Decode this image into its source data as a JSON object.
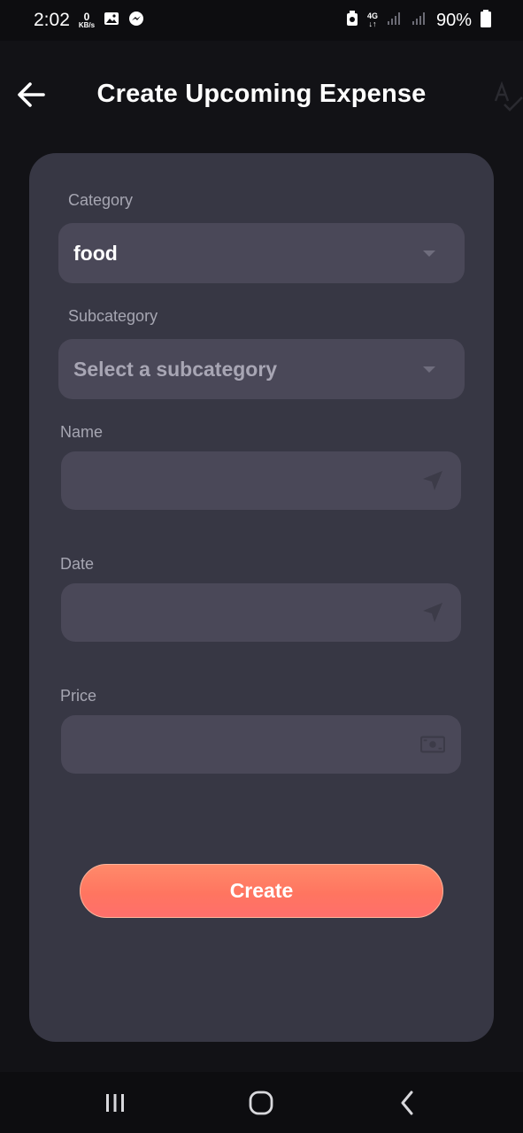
{
  "status_bar": {
    "time": "2:02",
    "data_speed_value": "0",
    "data_speed_unit": "KB/s",
    "network": "4G",
    "battery": "90%"
  },
  "app_bar": {
    "title": "Create Upcoming Expense"
  },
  "form": {
    "category": {
      "label": "Category",
      "value": "food"
    },
    "subcategory": {
      "label": "Subcategory",
      "placeholder": "Select a subcategory"
    },
    "name": {
      "label": "Name",
      "value": ""
    },
    "date": {
      "label": "Date",
      "value": ""
    },
    "price": {
      "label": "Price",
      "value": ""
    },
    "submit_label": "Create"
  },
  "colors": {
    "background": "#121216",
    "card": "#373744",
    "field": "#4a4858",
    "accent": "#ff7a62"
  },
  "icons": {
    "back": "arrow-left-icon",
    "spell": "spellcheck-icon",
    "name_field": "navigation-arrow-icon",
    "date_field": "navigation-arrow-icon",
    "price_field": "money-icon"
  }
}
